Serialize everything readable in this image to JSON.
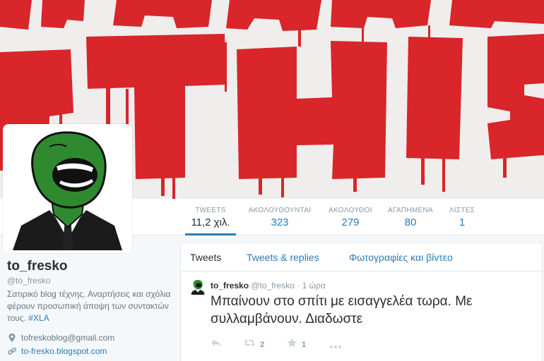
{
  "profile": {
    "name": "to_fresko",
    "handle": "@to_fresko",
    "bio_text": "Σατιρικό blog τέχνης. Αναρτήσεις και σχόλια φέρουν προσωπική άποψη των συντακτών τους.",
    "bio_hashtag": "#XLA",
    "email": "tofreskoblog@gmail.com",
    "website": "to-fresko.blogspot.com"
  },
  "stats": [
    {
      "label": "TWEETS",
      "value": "11,2 χιλ."
    },
    {
      "label": "ΑΚΟΛΟΥΘΟΥΝΤΑΙ",
      "value": "323"
    },
    {
      "label": "ΑΚΟΛΟΥΘΟΙ",
      "value": "279"
    },
    {
      "label": "ΑΓΑΠΗΜΕΝΑ",
      "value": "80"
    },
    {
      "label": "ΛΙΣΤΕΣ",
      "value": "1"
    }
  ],
  "tabs": [
    {
      "label": "Tweets"
    },
    {
      "label": "Tweets & replies"
    },
    {
      "label": "Φωτογραφίες και βίντεο"
    }
  ],
  "tweet": {
    "fullname": "to_fresko",
    "username": "@to_fresko",
    "separator": "·",
    "time": "1 ώρα",
    "text": "Μπαίνουν στο σπίτι με εισαγγελέα τωρα. Με συλλαμβάνουν. Διαδωστε",
    "retweets": "2",
    "favorites": "1"
  },
  "icons": {
    "reply": "reply-icon",
    "retweet": "retweet-icon",
    "favorite": "star-icon",
    "more": "more-dots-icon",
    "location": "location-pin-icon",
    "link": "link-icon"
  },
  "colors": {
    "link": "#2b7bb9",
    "banner_paint": "#d8262a",
    "avatar_green": "#2f8a2f"
  }
}
